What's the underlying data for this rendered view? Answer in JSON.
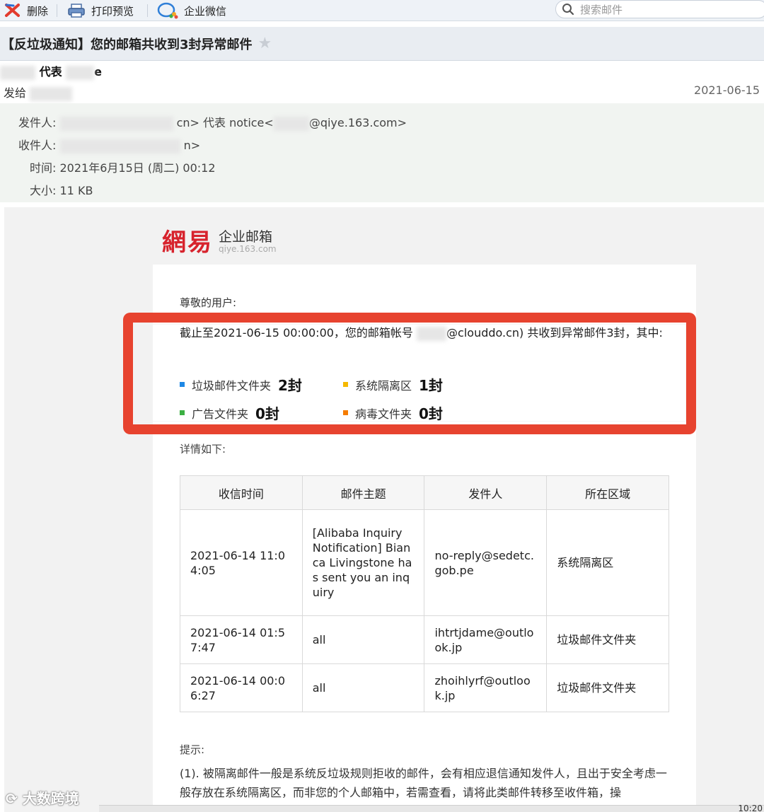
{
  "toolbar": {
    "delete_label": "删除",
    "print_label": "打印预览",
    "wecom_label": "企业微信",
    "search_placeholder": "搜索邮件"
  },
  "mail": {
    "subject": "【反垃圾通知】您的邮箱共收到3封异常邮件",
    "from_short": "代表",
    "from_short_suffix": "e",
    "to_prefix": "发给",
    "date": "2021-06-15",
    "sender_label": "发件人:",
    "sender_tail": "cn> 代表 notice<",
    "sender_domain": "@qiye.163.com>",
    "receiver_label": "收件人:",
    "receiver_tail": "n>",
    "time_label": "时间:",
    "time_value": "2021年6月15日 (周二) 00:12",
    "size_label": "大小:",
    "size_value": "11 KB"
  },
  "body": {
    "logo_brand": "網易",
    "logo_cn": "企业邮箱",
    "logo_en": "qiye.163.com",
    "greeting": "尊敬的用户:",
    "notice_prefix": "截止至2021-06-15 00:00:00，您的邮箱帐号",
    "notice_suffix": "@clouddo.cn) 共收到异常邮件3封，其中:",
    "stats": [
      {
        "label": "垃圾邮件文件夹",
        "count": "2封",
        "color": "#1e88e5"
      },
      {
        "label": "系统隔离区",
        "count": "1封",
        "color": "#f5b800"
      },
      {
        "label": "广告文件夹",
        "count": "0封",
        "color": "#3cb043"
      },
      {
        "label": "病毒文件夹",
        "count": "0封",
        "color": "#f57c00"
      }
    ],
    "details_label": "详情如下:",
    "table": {
      "headers": [
        "收信时间",
        "邮件主题",
        "发件人",
        "所在区域"
      ],
      "rows": [
        [
          "2021-06-14 11:04:05",
          "[Alibaba Inquiry Notification] Bianca Livingstone has sent you an inquiry",
          "no-reply@sedetc.gob.pe",
          "系统隔离区"
        ],
        [
          "2021-06-14 01:57:47",
          "all",
          "ihtrtjdame@outlook.jp",
          "垃圾邮件文件夹"
        ],
        [
          "2021-06-14 00:06:27",
          "all",
          "zhoihlyrf@outlook.jp",
          "垃圾邮件文件夹"
        ]
      ]
    },
    "tip_label": "提示:",
    "tip_text": "(1). 被隔离邮件一般是系统反垃圾规则拒收的邮件，会有相应退信通知发件人，且出于安全考虑一般存放在系统隔离区，而非您的个人邮箱中，若需查看，请将此类邮件转移至收件箱，操"
  },
  "watermark": "大数跨境",
  "clock": "10:20"
}
